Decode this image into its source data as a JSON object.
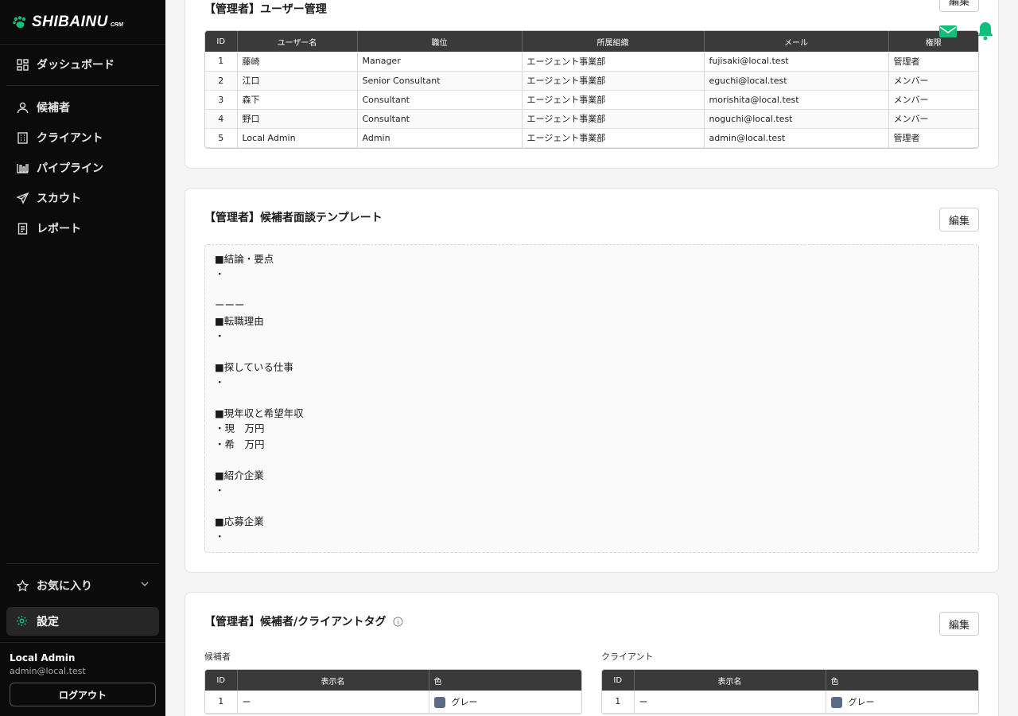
{
  "brand": {
    "name": "SHIBAINU",
    "sub": "CRM",
    "accent": "#10c07a"
  },
  "sidebar": {
    "dashboard": "ダッシュボード",
    "items": [
      {
        "label": "候補者",
        "icon": "person-icon"
      },
      {
        "label": "クライアント",
        "icon": "building-icon"
      },
      {
        "label": "パイプライン",
        "icon": "pipeline-icon"
      },
      {
        "label": "スカウト",
        "icon": "send-icon"
      },
      {
        "label": "レポート",
        "icon": "report-icon"
      }
    ],
    "favorites": "お気に入り",
    "settings": "設定",
    "user": {
      "name": "Local Admin",
      "email": "admin@local.test"
    },
    "logout": "ログアウト"
  },
  "users_card": {
    "title": "【管理者】ユーザー管理",
    "edit": "編集",
    "columns": [
      "ID",
      "ユーザー名",
      "職位",
      "所属組織",
      "メール",
      "権限"
    ],
    "rows": [
      [
        "1",
        "藤崎",
        "Manager",
        "エージェント事業部",
        "fujisaki@local.test",
        "管理者"
      ],
      [
        "2",
        "江口",
        "Senior Consultant",
        "エージェント事業部",
        "eguchi@local.test",
        "メンバー"
      ],
      [
        "3",
        "森下",
        "Consultant",
        "エージェント事業部",
        "morishita@local.test",
        "メンバー"
      ],
      [
        "4",
        "野口",
        "Consultant",
        "エージェント事業部",
        "noguchi@local.test",
        "メンバー"
      ],
      [
        "5",
        "Local Admin",
        "Admin",
        "エージェント事業部",
        "admin@local.test",
        "管理者"
      ]
    ]
  },
  "template_card": {
    "title": "【管理者】候補者面談テンプレート",
    "edit": "編集",
    "body": "■結論・要点\n・\n\nーーー\n■転職理由\n・\n\n■探している仕事\n・\n\n■現年収と希望年収\n・現　万円\n・希　万円\n\n■紹介企業\n・\n\n■応募企業\n・"
  },
  "tags_card": {
    "title": "【管理者】候補者/クライアントタグ",
    "edit": "編集",
    "candidate_label": "候補者",
    "client_label": "クライアント",
    "columns": [
      "ID",
      "表示名",
      "色"
    ],
    "candidate_rows": [
      [
        "1",
        "ー",
        "グレー"
      ]
    ],
    "client_rows": [
      [
        "1",
        "ー",
        "グレー"
      ]
    ],
    "swatch_color": "#5b6b85"
  },
  "header_icons": {
    "mail": "mail-icon",
    "bell": "bell-icon"
  }
}
